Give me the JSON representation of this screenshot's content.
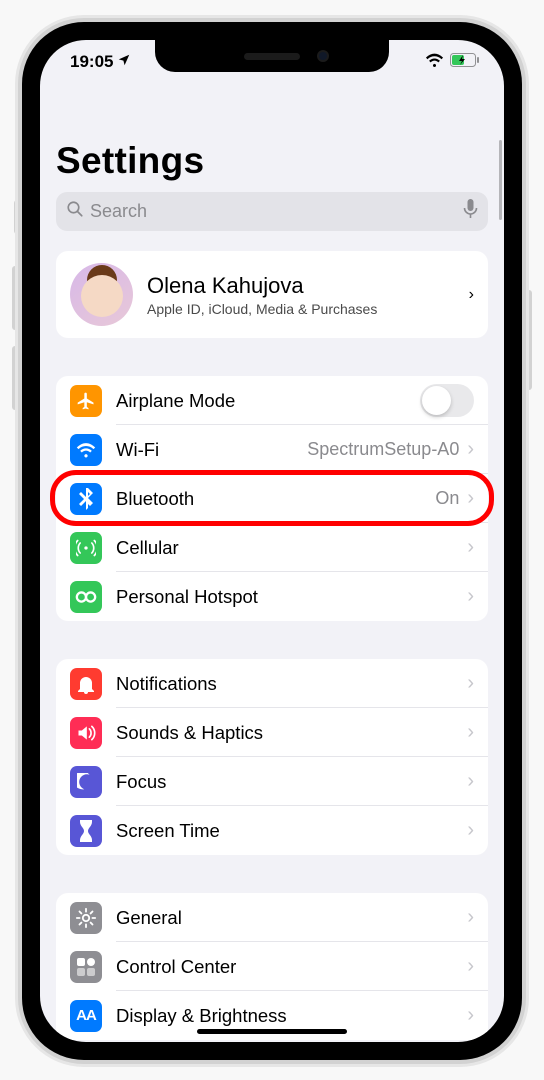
{
  "status": {
    "time": "19:05",
    "location_icon": "location-arrow"
  },
  "title": "Settings",
  "search": {
    "placeholder": "Search"
  },
  "profile": {
    "name": "Olena Kahujova",
    "subtitle": "Apple ID, iCloud, Media & Purchases"
  },
  "group1": {
    "airplane": {
      "label": "Airplane Mode",
      "icon_bg": "#ff9500"
    },
    "wifi": {
      "label": "Wi-Fi",
      "value": "SpectrumSetup-A0",
      "icon_bg": "#007aff"
    },
    "bluetooth": {
      "label": "Bluetooth",
      "value": "On",
      "icon_bg": "#007aff"
    },
    "cellular": {
      "label": "Cellular",
      "icon_bg": "#34c759"
    },
    "hotspot": {
      "label": "Personal Hotspot",
      "icon_bg": "#34c759"
    }
  },
  "group2": {
    "notifications": {
      "label": "Notifications",
      "icon_bg": "#ff3b30"
    },
    "sounds": {
      "label": "Sounds & Haptics",
      "icon_bg": "#ff2d55"
    },
    "focus": {
      "label": "Focus",
      "icon_bg": "#5856d6"
    },
    "screentime": {
      "label": "Screen Time",
      "icon_bg": "#5856d6"
    }
  },
  "group3": {
    "general": {
      "label": "General",
      "icon_bg": "#8e8e93"
    },
    "controlcenter": {
      "label": "Control Center",
      "icon_bg": "#8e8e93"
    },
    "display": {
      "label": "Display & Brightness",
      "icon_bg": "#007aff"
    }
  },
  "highlight": {
    "target": "bluetooth"
  }
}
